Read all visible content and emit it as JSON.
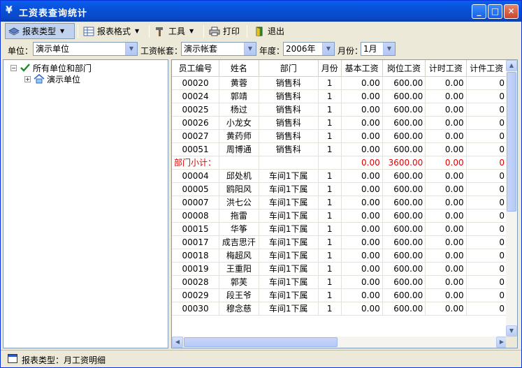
{
  "window": {
    "title": "工资表查询统计"
  },
  "toolbar": {
    "report_type": "报表类型",
    "report_format": "报表格式",
    "tools": "工具",
    "print": "打印",
    "exit": "退出"
  },
  "filters": {
    "unit_label": "单位：",
    "unit_value": "演示单位",
    "account_label": "工资帐套：",
    "account_value": "演示帐套",
    "year_label": "年度：",
    "year_value": "2006年",
    "month_label": "月份：",
    "month_value": "1月"
  },
  "tree": {
    "root": "所有单位和部门",
    "child": "演示单位"
  },
  "grid": {
    "columns": [
      "员工编号",
      "姓名",
      "部门",
      "月份",
      "基本工资",
      "岗位工资",
      "计时工资",
      "计件工资"
    ],
    "rows": [
      [
        "00020",
        "黄蓉",
        "销售科",
        "1",
        "0.00",
        "600.00",
        "0.00",
        "0"
      ],
      [
        "00024",
        "郭靖",
        "销售科",
        "1",
        "0.00",
        "600.00",
        "0.00",
        "0"
      ],
      [
        "00025",
        "杨过",
        "销售科",
        "1",
        "0.00",
        "600.00",
        "0.00",
        "0"
      ],
      [
        "00026",
        "小龙女",
        "销售科",
        "1",
        "0.00",
        "600.00",
        "0.00",
        "0"
      ],
      [
        "00027",
        "黄药师",
        "销售科",
        "1",
        "0.00",
        "600.00",
        "0.00",
        "0"
      ],
      [
        "00051",
        "周博通",
        "销售科",
        "1",
        "0.00",
        "600.00",
        "0.00",
        "0"
      ]
    ],
    "subtotal": {
      "label": "部门小计：",
      "basic": "0.00",
      "post": "3600.00",
      "time": "0.00",
      "piece": "0"
    },
    "rows2": [
      [
        "00004",
        "邱处机",
        "车间1下属",
        "1",
        "0.00",
        "600.00",
        "0.00",
        "0"
      ],
      [
        "00005",
        "鸥阳风",
        "车间1下属",
        "1",
        "0.00",
        "600.00",
        "0.00",
        "0"
      ],
      [
        "00007",
        "洪七公",
        "车间1下属",
        "1",
        "0.00",
        "600.00",
        "0.00",
        "0"
      ],
      [
        "00008",
        "拖雷",
        "车间1下属",
        "1",
        "0.00",
        "600.00",
        "0.00",
        "0"
      ],
      [
        "00015",
        "华筝",
        "车间1下属",
        "1",
        "0.00",
        "600.00",
        "0.00",
        "0"
      ],
      [
        "00017",
        "成吉思汗",
        "车间1下属",
        "1",
        "0.00",
        "600.00",
        "0.00",
        "0"
      ],
      [
        "00018",
        "梅超风",
        "车间1下属",
        "1",
        "0.00",
        "600.00",
        "0.00",
        "0"
      ],
      [
        "00019",
        "王重阳",
        "车间1下属",
        "1",
        "0.00",
        "600.00",
        "0.00",
        "0"
      ],
      [
        "00028",
        "郭芙",
        "车间1下属",
        "1",
        "0.00",
        "600.00",
        "0.00",
        "0"
      ],
      [
        "00029",
        "段王爷",
        "车间1下属",
        "1",
        "0.00",
        "600.00",
        "0.00",
        "0"
      ],
      [
        "00030",
        "穆念慈",
        "车间1下属",
        "1",
        "0.00",
        "600.00",
        "0.00",
        "0"
      ]
    ]
  },
  "status": {
    "text": "报表类型：月工资明细"
  },
  "colors": {
    "title_bar": "#0A5FEF",
    "subtotal_text": "#E00000",
    "window_bg": "#ECE9D8"
  }
}
